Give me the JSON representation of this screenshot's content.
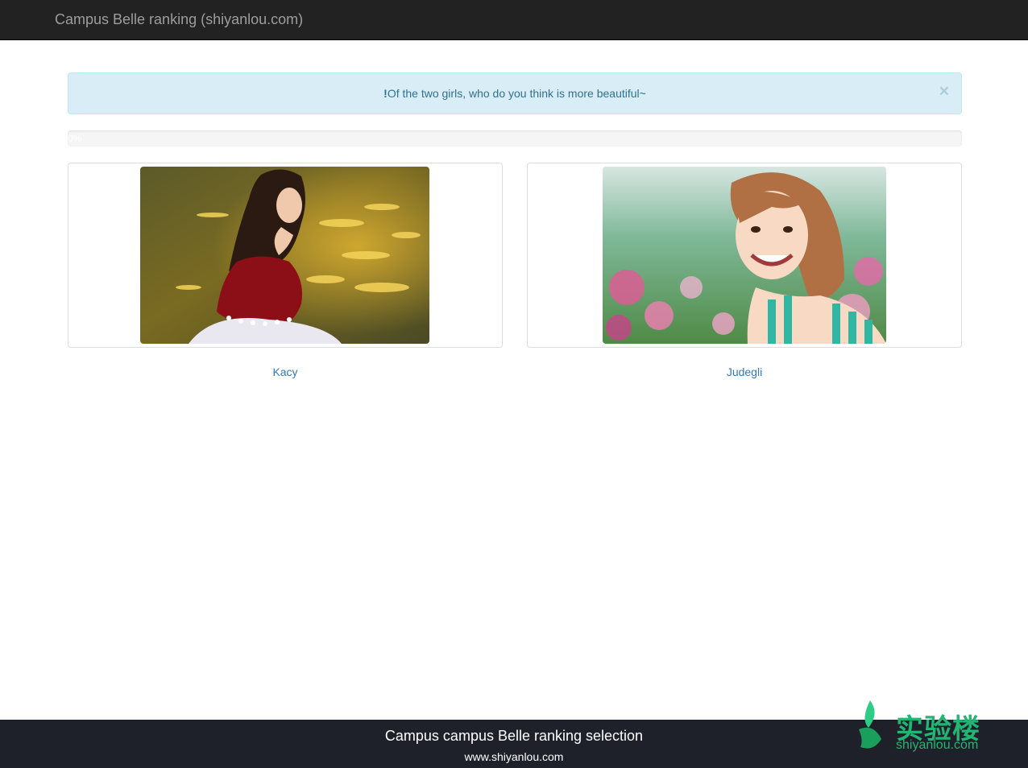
{
  "navbar": {
    "brand": "Campus Belle ranking (shiyanlou.com)"
  },
  "alert": {
    "prefix": "!",
    "message": "Of the two girls, who do you think is more beautiful~",
    "close_label": "×"
  },
  "progress": {
    "value": 0,
    "label": "0%"
  },
  "candidates": [
    {
      "name": "Kacy"
    },
    {
      "name": "Judegli"
    }
  ],
  "footer": {
    "title": "Campus campus Belle ranking selection",
    "url": "www.shiyanlou.com"
  },
  "watermark": {
    "chinese": "实验楼",
    "domain": "shiyanlou.com"
  },
  "colors": {
    "navbar": "#222222",
    "alert_bg": "#d9edf7",
    "alert_text": "#31708f",
    "link": "#337ab7",
    "footer": "#1e2129",
    "brand_green": "#22b573"
  }
}
